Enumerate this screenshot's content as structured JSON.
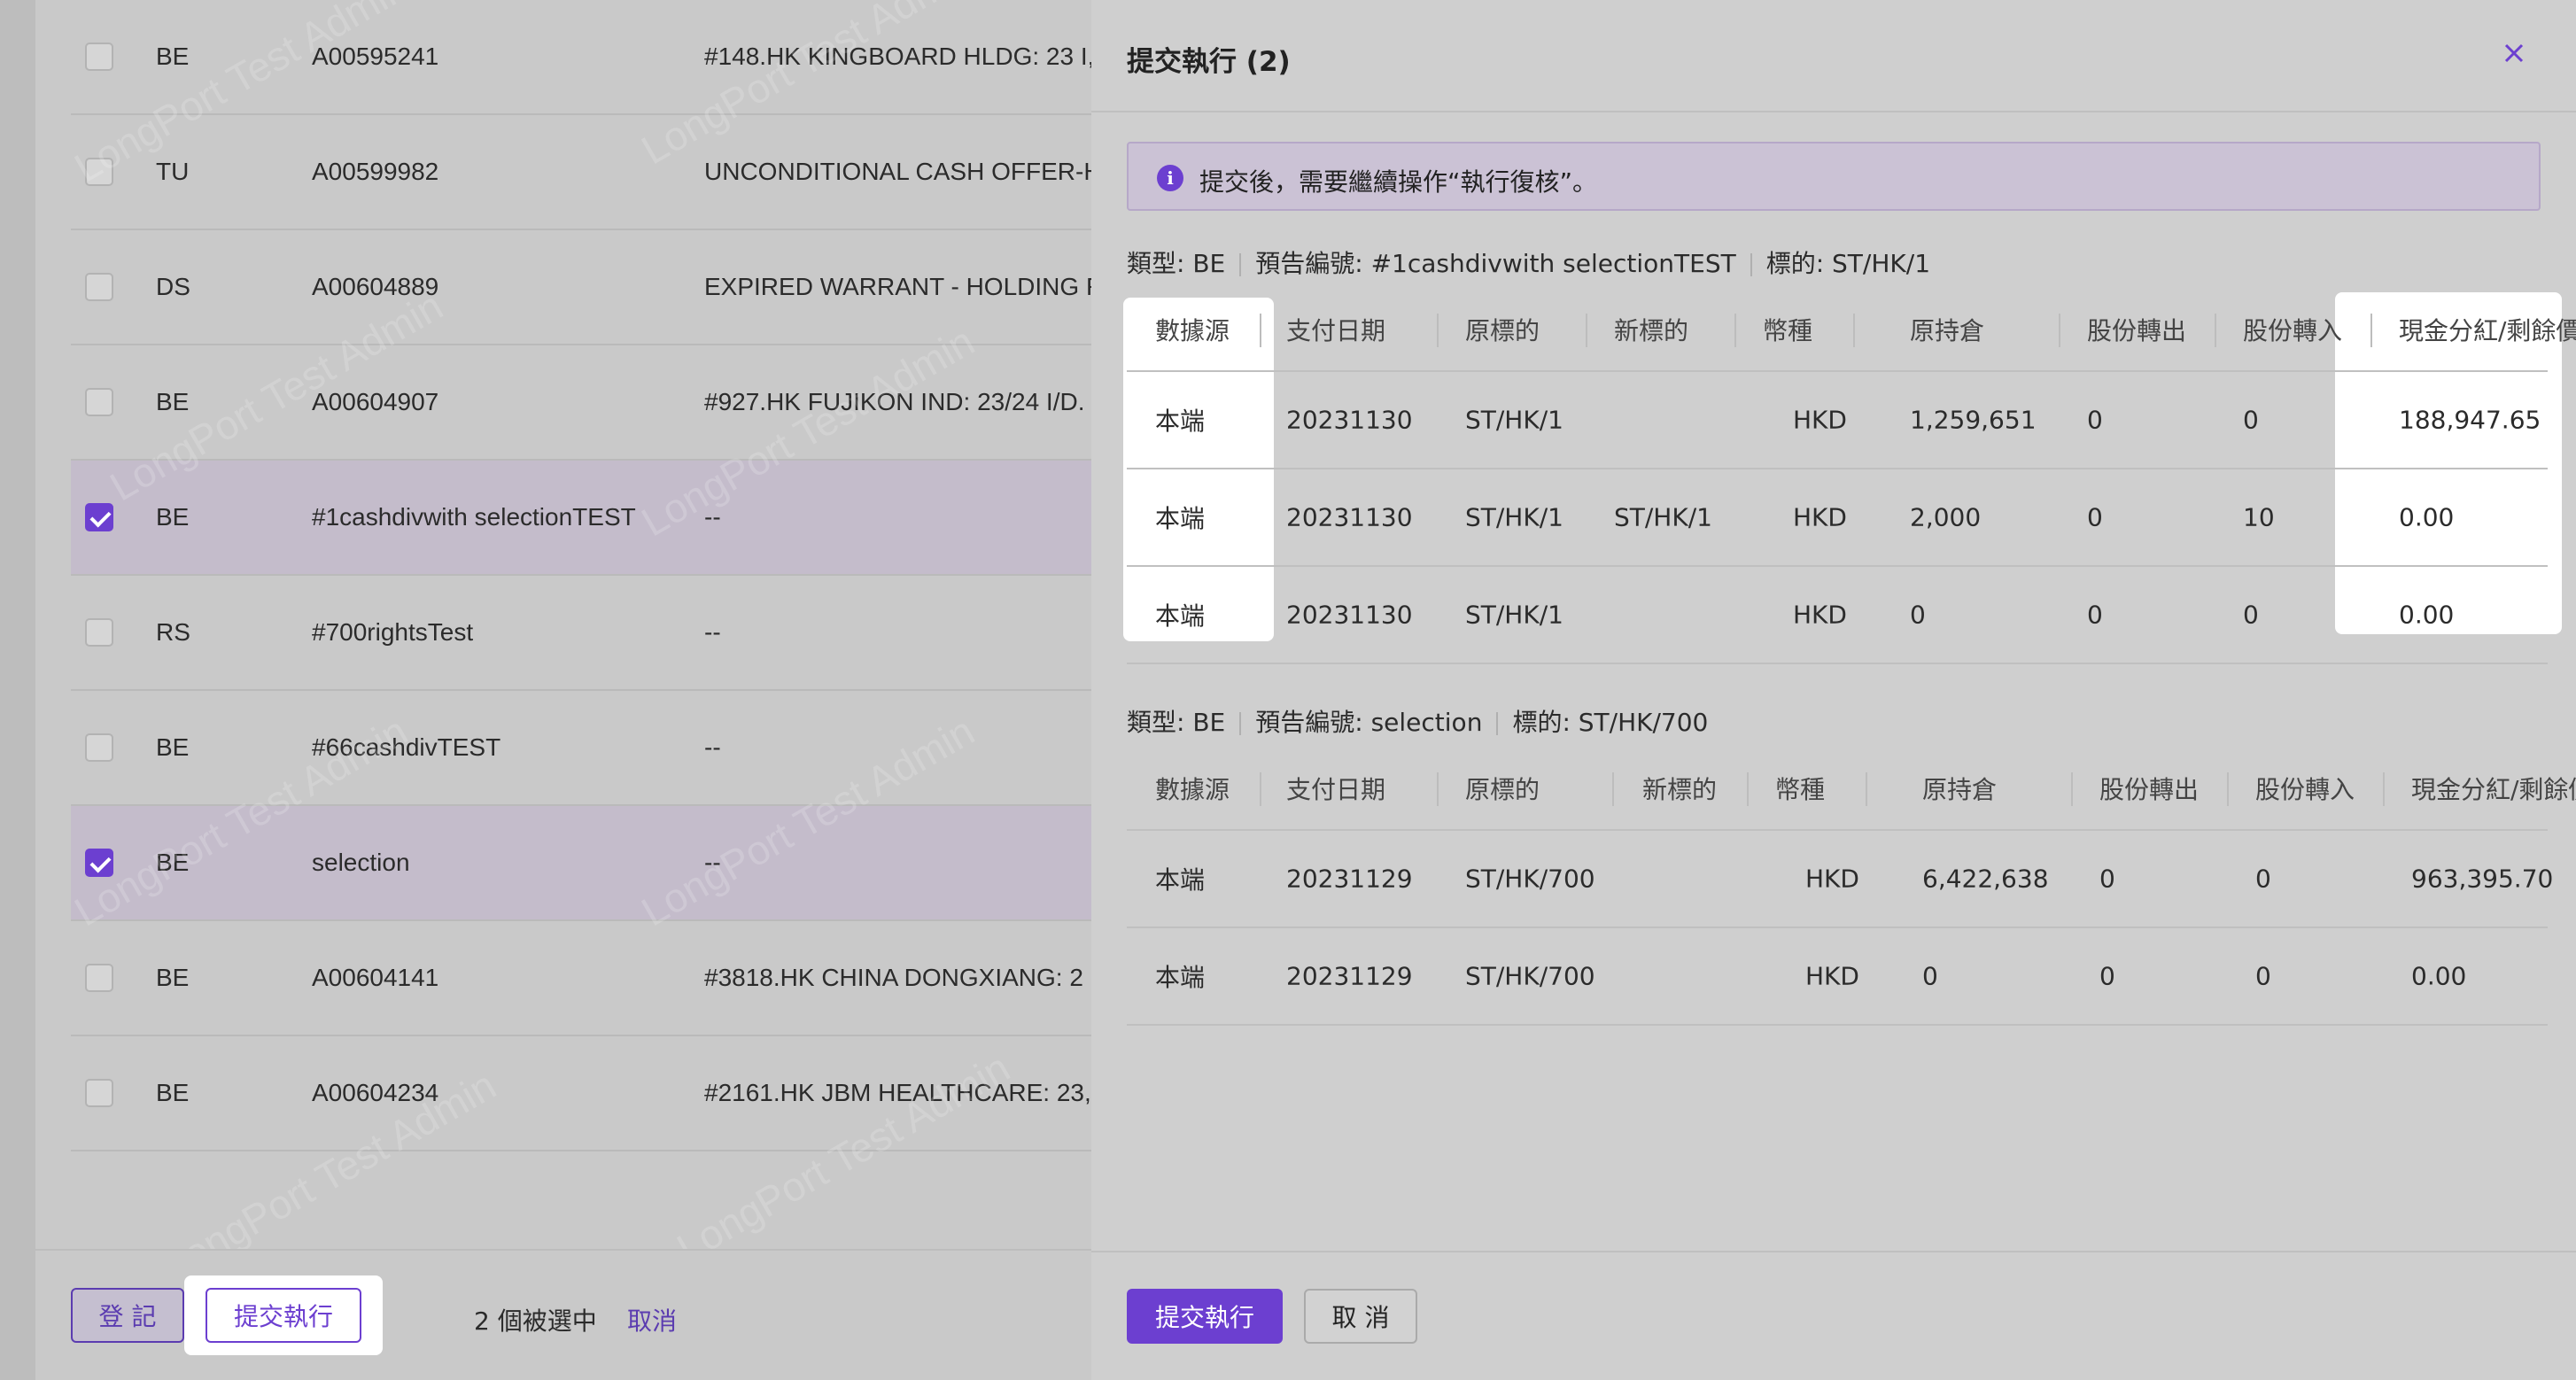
{
  "list": {
    "rows": [
      {
        "checked": false,
        "type": "BE",
        "id": "A00595241",
        "desc": "#148.HK KINGBOARD HLDG: 23 I,"
      },
      {
        "checked": false,
        "type": "TU",
        "id": "A00599982",
        "desc": "UNCONDITIONAL CASH OFFER-H"
      },
      {
        "checked": false,
        "type": "DS",
        "id": "A00604889",
        "desc": "EXPIRED WARRANT - HOLDING R"
      },
      {
        "checked": false,
        "type": "BE",
        "id": "A00604907",
        "desc": "#927.HK FUJIKON IND: 23/24 I/D."
      },
      {
        "checked": true,
        "type": "BE",
        "id": "#1cashdivwith selectionTEST",
        "desc": "--"
      },
      {
        "checked": false,
        "type": "RS",
        "id": "#700rightsTest",
        "desc": "--"
      },
      {
        "checked": false,
        "type": "BE",
        "id": "#66cashdivTEST",
        "desc": "--"
      },
      {
        "checked": true,
        "type": "BE",
        "id": "selection",
        "desc": "--"
      },
      {
        "checked": false,
        "type": "BE",
        "id": "A00604141",
        "desc": "#3818.HK CHINA DONGXIANG: 2"
      },
      {
        "checked": false,
        "type": "BE",
        "id": "A00604234",
        "desc": "#2161.HK JBM HEALTHCARE: 23,"
      }
    ],
    "watermark": "LongPort Test Admin"
  },
  "footer_left": {
    "register_label": "登 記",
    "submit_label": "提交執行",
    "selected_count": "2 個被選中",
    "cancel_link": "取消"
  },
  "drawer": {
    "title": "提交執行 (2)",
    "alert": "提交後，需要繼續操作“執行復核”。",
    "groups": [
      {
        "type": "類型: BE",
        "notice": "預告編號: #1cashdivwith selectionTEST",
        "target": "標的: ST/HK/1",
        "headers": [
          "數據源",
          "支付日期",
          "原標的",
          "新標的",
          "幣種",
          "原持倉",
          "股份轉出",
          "股份轉入",
          "現金分紅/剩餘價"
        ],
        "rows": [
          [
            "本端",
            "20231130",
            "ST/HK/1",
            "",
            "HKD",
            "1,259,651",
            "0",
            "0",
            "188,947.65"
          ],
          [
            "本端",
            "20231130",
            "ST/HK/1",
            "ST/HK/1",
            "HKD",
            "2,000",
            "0",
            "10",
            "0.00"
          ],
          [
            "本端",
            "20231130",
            "ST/HK/1",
            "",
            "HKD",
            "0",
            "0",
            "0",
            "0.00"
          ]
        ]
      },
      {
        "type": "類型: BE",
        "notice": "預告編號: selection",
        "target": "標的: ST/HK/700",
        "headers": [
          "數據源",
          "支付日期",
          "原標的",
          "新標的",
          "幣種",
          "原持倉",
          "股份轉出",
          "股份轉入",
          "現金分紅/剩餘價"
        ],
        "rows": [
          [
            "本端",
            "20231129",
            "ST/HK/700",
            "",
            "HKD",
            "6,422,638",
            "0",
            "0",
            "963,395.70"
          ],
          [
            "本端",
            "20231129",
            "ST/HK/700",
            "",
            "HKD",
            "0",
            "0",
            "0",
            "0.00"
          ]
        ]
      }
    ],
    "submit_label": "提交執行",
    "cancel_label": "取 消"
  }
}
